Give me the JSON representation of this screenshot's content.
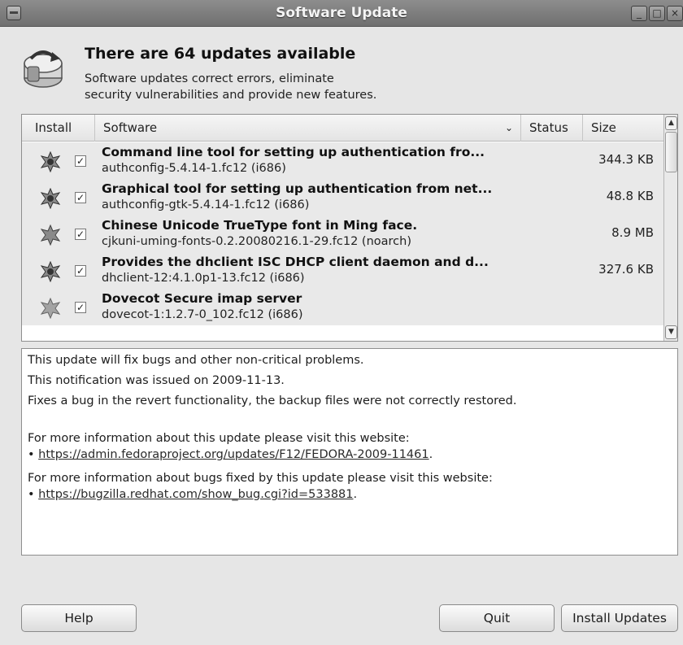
{
  "window": {
    "title": "Software Update"
  },
  "header": {
    "title": "There are 64 updates available",
    "subtitle_line1": "Software updates correct errors, eliminate",
    "subtitle_line2": "security vulnerabilities and provide new features."
  },
  "columns": {
    "install": "Install",
    "software": "Software",
    "status": "Status",
    "size": "Size"
  },
  "updates": [
    {
      "name": "Command line tool for setting up authentication fro...",
      "package": "authconfig-5.4.14-1.fc12 (i686)",
      "size": "344.3 KB",
      "checked": true
    },
    {
      "name": "Graphical tool for setting up authentication from net...",
      "package": "authconfig-gtk-5.4.14-1.fc12 (i686)",
      "size": "48.8 KB",
      "checked": true
    },
    {
      "name": "Chinese Unicode TrueType font in Ming face.",
      "package": "cjkuni-uming-fonts-0.2.20080216.1-29.fc12 (noarch)",
      "size": "8.9 MB",
      "checked": true
    },
    {
      "name": "Provides the dhclient ISC DHCP client daemon and d...",
      "package": "dhclient-12:4.1.0p1-13.fc12 (i686)",
      "size": "327.6 KB",
      "checked": true
    },
    {
      "name": "Dovecot Secure imap server",
      "package": "dovecot-1:1.2.7-0_102.fc12 (i686)",
      "size": "",
      "checked": true
    }
  ],
  "description": {
    "line1": "This update will fix bugs and other non-critical problems.",
    "line2": "This notification was issued on 2009-11-13.",
    "line3": "Fixes a bug in the revert functionality, the backup files were not correctly restored.",
    "info_update_text": "For more information about this update please visit this website:",
    "info_update_link": "https://admin.fedoraproject.org/updates/F12/FEDORA-2009-11461",
    "info_bugs_text": "For more information about bugs fixed by this update please visit this website:",
    "info_bugs_link": "https://bugzilla.redhat.com/show_bug.cgi?id=533881",
    "bullet": "•",
    "period": "."
  },
  "buttons": {
    "help": "Help",
    "quit": "Quit",
    "install": "Install Updates"
  },
  "icons": {
    "package": "package-update-icon",
    "checkbox": "checkbox-checked-icon",
    "software_update": "software-update-icon"
  },
  "symbols": {
    "check": "✓",
    "sort": "⌄",
    "up": "▲",
    "down": "▼"
  }
}
